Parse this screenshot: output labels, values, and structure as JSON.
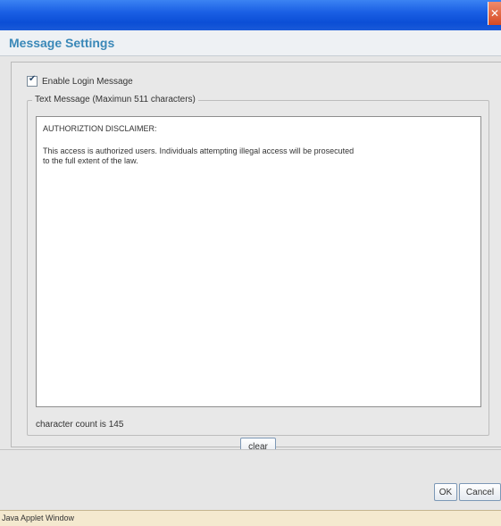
{
  "window": {
    "close_glyph": "✕"
  },
  "header": {
    "title": "Message Settings"
  },
  "login_message": {
    "enable_label": "Enable Login Message",
    "enabled": true
  },
  "text_message": {
    "legend": "Text Message (Maximun 511 characters)",
    "lines": [
      "AUTHORIZTION DISCLAIMER:",
      "",
      "This access is authorized users. Individuals attempting illegal access will be prosecuted",
      "to the full extent of the law."
    ],
    "char_count_text": "character count is 145",
    "clear_label": "clear"
  },
  "footer": {
    "ok_label": "OK",
    "cancel_label": "Cancel"
  },
  "status_bar": {
    "text": "Java Applet Window"
  },
  "colors": {
    "title_bar": "#1a5fe4",
    "header_title": "#3a88b8",
    "close_button": "#d64a22",
    "status_bar": "#f4e9cf"
  }
}
